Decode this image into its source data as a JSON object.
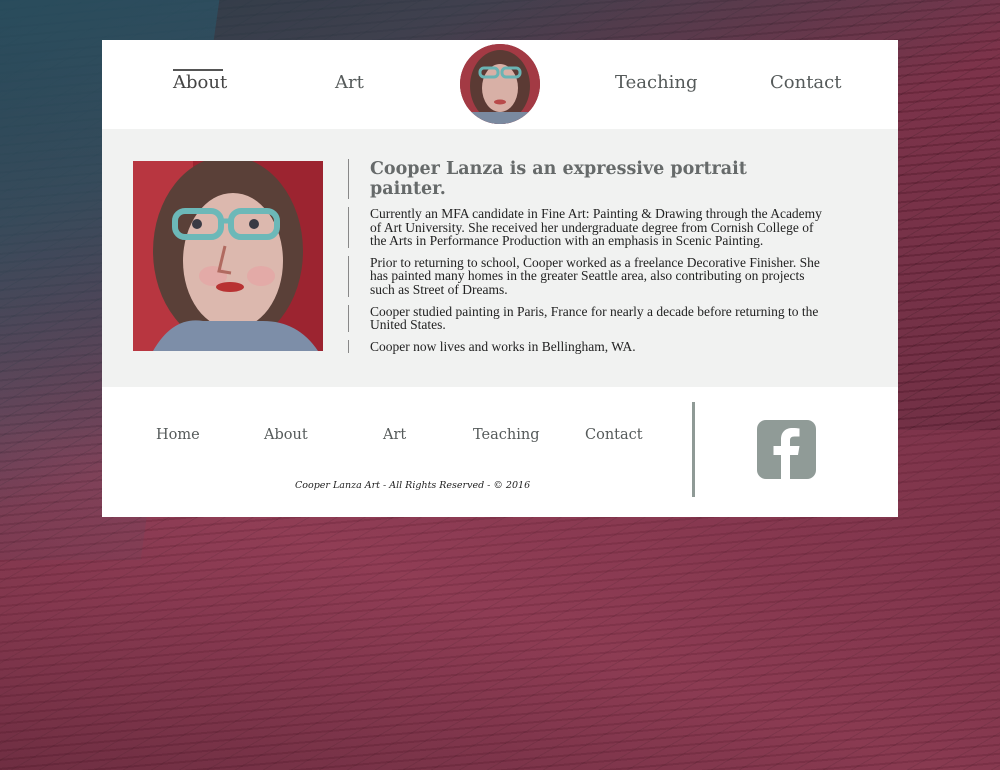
{
  "header": {
    "nav": [
      {
        "label": "About",
        "active": true
      },
      {
        "label": "Art",
        "active": false
      },
      {
        "label": "Teaching",
        "active": false
      },
      {
        "label": "Contact",
        "active": false
      }
    ],
    "avatar_icon": "profile-portrait"
  },
  "main": {
    "title": "Cooper Lanza is an expressive portrait painter.",
    "paragraphs": [
      "Currently an MFA candidate in Fine Art: Painting & Drawing through the Academy of Art University. She received her undergraduate degree from Cornish College of the Arts in Performance Production with an emphasis in Scenic Painting.",
      "Prior to returning to school, Cooper worked as a freelance Decorative Finisher. She has painted many homes in the greater Seattle area, also contributing on projects such as Street of Dreams.",
      "Cooper studied painting in Paris, France for nearly a decade before returning to the United States.",
      "Cooper now lives and works in Bellingham, WA."
    ]
  },
  "footer": {
    "nav": [
      "Home",
      "About",
      "Art",
      "Teaching",
      "Contact"
    ],
    "copyright": "Cooper Lanza Art - All Rights Reserved - © 2016",
    "social_icon": "facebook-icon"
  },
  "colors": {
    "nav_text": "#555a5a",
    "main_bg": "#f1f2f1",
    "facebook_bg": "#909b97",
    "divider": "#8f9a96"
  }
}
